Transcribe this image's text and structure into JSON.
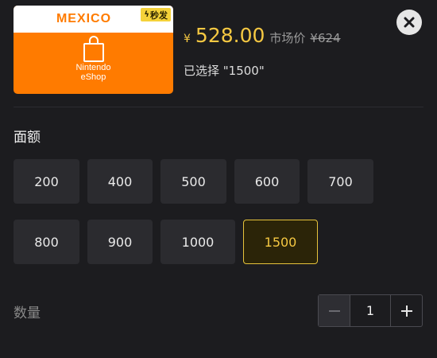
{
  "product": {
    "card_region": "MEXICO",
    "card_badge": "秒发",
    "card_shop_line1": "Nintendo",
    "card_shop_line2": "eShop",
    "price_symbol": "¥",
    "price": "528.00",
    "market_label": "市场价",
    "market_price": "¥624",
    "selected_text": "已选择 \"1500\""
  },
  "denomination": {
    "title": "面额",
    "options": [
      {
        "label": "200",
        "selected": false
      },
      {
        "label": "400",
        "selected": false
      },
      {
        "label": "500",
        "selected": false
      },
      {
        "label": "600",
        "selected": false
      },
      {
        "label": "700",
        "selected": false
      },
      {
        "label": "800",
        "selected": false
      },
      {
        "label": "900",
        "selected": false
      },
      {
        "label": "1000",
        "selected": false
      },
      {
        "label": "1500",
        "selected": true
      }
    ]
  },
  "quantity": {
    "label": "数量",
    "value": "1",
    "minus_disabled": true
  },
  "icons": {
    "close": "close-icon",
    "minus": "minus-icon",
    "plus": "plus-icon",
    "bag": "shopping-bag-icon",
    "bolt": "lightning-bolt-icon"
  },
  "colors": {
    "accent": "#f5c842",
    "card_orange": "#ff7b00",
    "background": "#1c1c1f",
    "option_bg": "#2b2b2f"
  }
}
